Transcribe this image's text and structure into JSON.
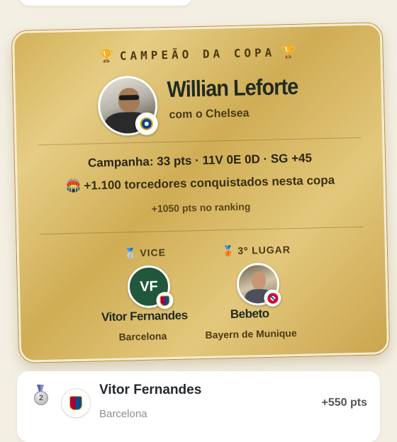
{
  "champion_card": {
    "title": "CAMPEÃO DA COPA",
    "trophy_icon": "🏆",
    "champion": {
      "name": "Willian Leforte",
      "club_text": "com o Chelsea",
      "club_badge_icon": "chelsea-crest"
    },
    "campaign": "Campanha: 33 pts · 11V 0E 0D · SG +45",
    "fans_icon": "🏟️",
    "fans": "+1.100 torcedores conquistados nesta copa",
    "ranking_points": "+1050 pts no ranking",
    "vice": {
      "label": "VICE",
      "medal_icon": "🥈",
      "initials": "VF",
      "name": "Vitor Fernandes",
      "club": "Barcelona",
      "club_badge_icon": "barcelona-crest"
    },
    "third": {
      "label": "3º LUGAR",
      "medal_icon": "🥉",
      "name": "Bebeto",
      "club": "Bayern de Munique",
      "club_badge_icon": "bayern-crest"
    },
    "colors": {
      "gold": "#d3b259",
      "dark_text": "#1f2a21",
      "vice_avatar": "#21573a"
    }
  },
  "ranking_row": {
    "position": "2",
    "medal_icon": "silver-medal",
    "club_badge_icon": "barcelona-crest",
    "name": "Vitor Fernandes",
    "club": "Barcelona",
    "points": "+550 pts"
  }
}
